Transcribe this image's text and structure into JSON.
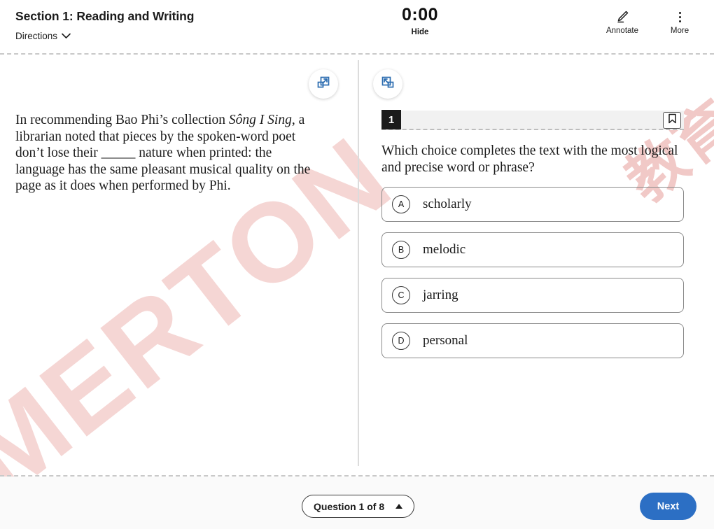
{
  "header": {
    "section_title": "Section 1: Reading and Writing",
    "directions_label": "Directions",
    "directions_icon": "chevron-down-icon",
    "timer": "0:00",
    "hide_label": "Hide",
    "annotate_label": "Annotate",
    "annotate_icon": "pencil-icon",
    "more_label": "More",
    "more_icon": "kebab-menu-icon"
  },
  "panes": {
    "expand_left_icon": "expand-arrow-icon",
    "collapse_right_icon": "collapse-arrow-icon"
  },
  "passage": {
    "part1": "In recommending Bao Phi’s collection ",
    "title_italic": "Sông I Sing",
    "part2": ", a librarian noted that pieces by the spoken-word poet don’t lose their ",
    "blank": "_____",
    "part3": " nature when printed: the language has the same pleasant musical quality on the page as it does when performed by Phi."
  },
  "question": {
    "number": "1",
    "bookmark_icon": "bookmark-icon",
    "stem": "Which choice completes the text with the most logical and precise word or phrase?",
    "choices": [
      {
        "letter": "A",
        "text": "scholarly"
      },
      {
        "letter": "B",
        "text": "melodic"
      },
      {
        "letter": "C",
        "text": "jarring"
      },
      {
        "letter": "D",
        "text": "personal"
      }
    ]
  },
  "footer": {
    "question_selector": "Question 1 of 8",
    "selector_icon": "caret-up-icon",
    "next_label": "Next"
  },
  "watermark": {
    "main_text": "MERTON",
    "cjk_text": "教育"
  },
  "colors": {
    "accent_blue": "#2c6fc4",
    "icon_blue": "#2b6cb0",
    "watermark_red": "#f4cfcd",
    "q_header_gray": "#f1f1f1",
    "footer_gray": "#fafafa"
  }
}
